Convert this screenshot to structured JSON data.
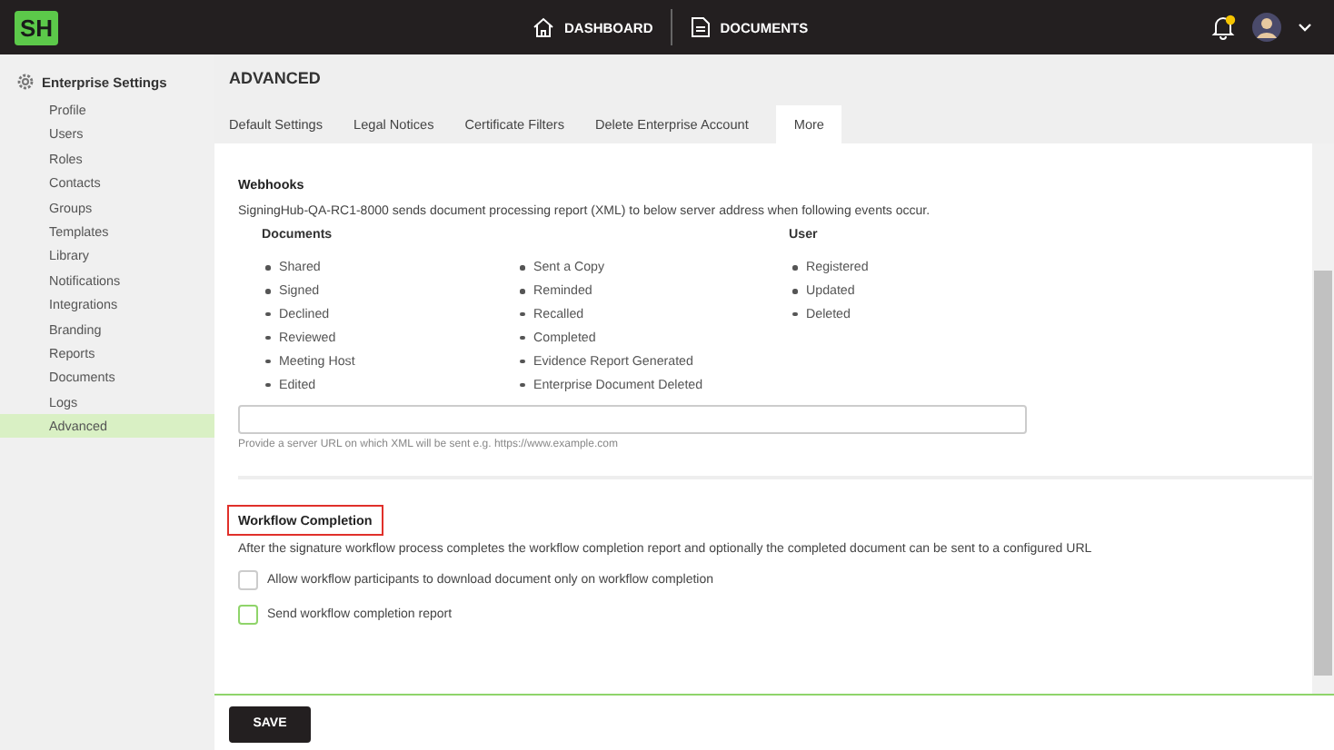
{
  "topbar": {
    "logo": "SH",
    "nav": [
      {
        "label": "DASHBOARD"
      },
      {
        "label": "DOCUMENTS"
      }
    ]
  },
  "sidebar": {
    "title": "Enterprise Settings",
    "items": [
      {
        "label": "Profile",
        "selected": false
      },
      {
        "label": "Users",
        "selected": false
      },
      {
        "label": "Roles",
        "selected": false
      },
      {
        "label": "Contacts",
        "selected": false
      },
      {
        "label": "Groups",
        "selected": false
      },
      {
        "label": "Templates",
        "selected": false
      },
      {
        "label": "Library",
        "selected": false
      },
      {
        "label": "Notifications",
        "selected": false
      },
      {
        "label": "Integrations",
        "selected": false
      },
      {
        "label": "Branding",
        "selected": false
      },
      {
        "label": "Reports",
        "selected": false
      },
      {
        "label": "Documents",
        "selected": false
      },
      {
        "label": "Logs",
        "selected": false
      },
      {
        "label": "Advanced",
        "selected": true
      }
    ]
  },
  "page_title": "ADVANCED",
  "tabs": [
    {
      "label": "Default Settings",
      "selected": false
    },
    {
      "label": "Legal Notices",
      "selected": false
    },
    {
      "label": "Certificate Filters",
      "selected": false
    },
    {
      "label": "Delete Enterprise Account",
      "selected": false
    },
    {
      "label": "More",
      "selected": true
    }
  ],
  "webhooks": {
    "title": "Webhooks",
    "description": "SigningHub-QA-RC1-8000 sends document processing report (XML) to below server address when following events occur.",
    "columns": [
      {
        "heading": "Documents",
        "items": [
          "Shared",
          "Signed",
          "Declined",
          "Reviewed",
          "Meeting Host",
          "Edited"
        ]
      },
      {
        "items": [
          "Sent a Copy",
          "Reminded",
          "Recalled",
          "Completed",
          "Evidence Report Generated",
          "Enterprise Document Deleted"
        ]
      },
      {
        "heading": "User",
        "items": [
          "Registered",
          "Updated",
          "Deleted"
        ]
      }
    ],
    "url_hint": "Provide a server URL on which XML will be sent e.g. https://www.example.com"
  },
  "workflow": {
    "title": "Workflow Completion",
    "highlighted": true,
    "description": "After the signature workflow process completes the workflow completion report and optionally the completed document can be sent to a configured URL",
    "options": [
      {
        "label": "Allow workflow participants to download document only on workflow completion",
        "checked": false,
        "color": "#cccccc"
      },
      {
        "label": "Send workflow completion report",
        "checked": false,
        "color": "#8fd46a"
      }
    ]
  },
  "save_button": "SAVE"
}
